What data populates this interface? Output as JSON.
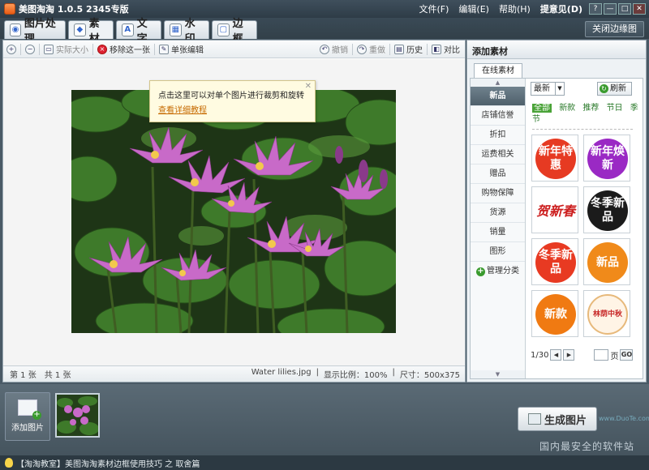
{
  "window": {
    "title": "美图淘淘 1.0.5 2345专版",
    "menu": [
      "文件(F)",
      "编辑(E)",
      "帮助(H)",
      "提意见(D)"
    ],
    "buttons": [
      "?",
      "—",
      "□",
      "✕"
    ]
  },
  "tabs": [
    {
      "label": "图片处理",
      "icon": "image-process-icon"
    },
    {
      "label": "素材",
      "icon": "material-icon"
    },
    {
      "label": "文字",
      "icon": "text-icon"
    },
    {
      "label": "水印",
      "icon": "watermark-icon"
    },
    {
      "label": "边框",
      "icon": "frame-icon"
    }
  ],
  "close_composite_label": "关闭边缘图",
  "toolbar": {
    "actual_size": "实际大小",
    "remove_one": "移除这一张",
    "single_edit": "单张编辑",
    "undo": "撤销",
    "redo": "重做",
    "history": "历史",
    "compare": "对比"
  },
  "tooltip": {
    "text": "点击这里可以对单个图片进行裁剪和旋转",
    "link": "查看详细教程"
  },
  "canvas": {
    "watermark": "www.duote.com"
  },
  "status": {
    "current": "第 1 张",
    "total": "共 1 张",
    "filename": "Water lilies.jpg",
    "ratio": "显示比例：100%",
    "size": "尺寸：500x375"
  },
  "right_panel": {
    "title": "添加素材",
    "online_tab": "在线素材",
    "categories": [
      "新品",
      "店铺信誉",
      "折扣",
      "运费相关",
      "赠品",
      "购物保障",
      "货源",
      "销量",
      "图形"
    ],
    "manage": "管理分类",
    "sort": "最新",
    "refresh": "刷新",
    "filters": [
      "全部",
      "新款",
      "推荐",
      "节日",
      "季节"
    ],
    "stickers": [
      {
        "text": "新年特惠",
        "color": "#e63a22"
      },
      {
        "text": "新年焕新",
        "color": "#9a29c4"
      },
      {
        "text": "贺新春",
        "color": "#cc1e1e"
      },
      {
        "text": "冬季新品",
        "color": "#1b1b1b"
      },
      {
        "text": "冬季新品",
        "color": "#e83a22"
      },
      {
        "text": "新品",
        "color": "#f08a1a"
      },
      {
        "text": "新款",
        "color": "#f07a12"
      },
      {
        "text": "林荫中秋",
        "color": "#c82a2a"
      }
    ],
    "pager": {
      "page": "1/30",
      "page_label": "页",
      "go": "GO"
    }
  },
  "bottom": {
    "add_image": "添加图片",
    "generate": "生成图片",
    "watermark": "国内最安全的软件站",
    "site": "www.DuoTe.com"
  },
  "footer": {
    "text": "【淘淘教室】美图淘淘素材边框使用技巧 之 取舍篇"
  }
}
